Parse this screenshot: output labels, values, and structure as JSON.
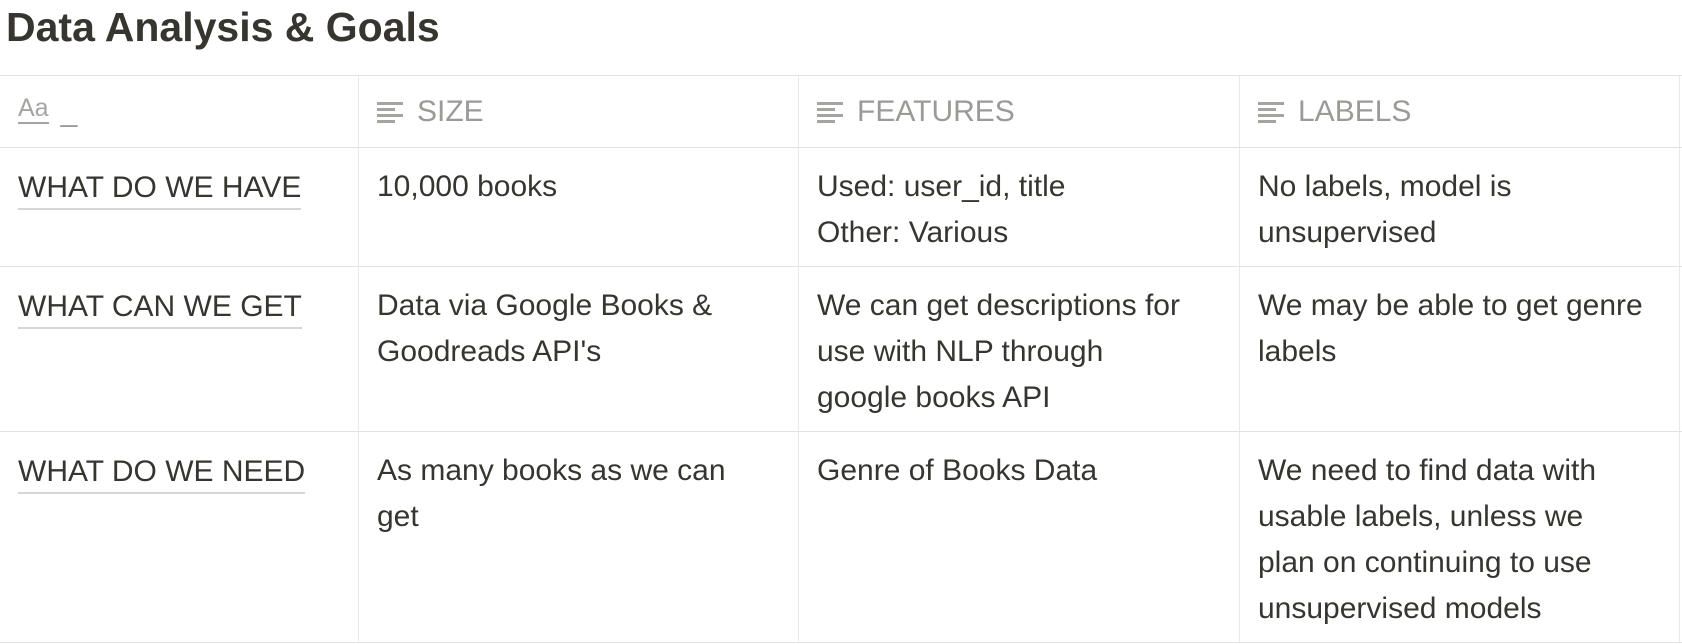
{
  "page": {
    "title": "Data Analysis & Goals"
  },
  "table": {
    "columns": [
      {
        "label": "_",
        "icon": "title-property-icon"
      },
      {
        "label": "SIZE",
        "icon": "text-property-icon"
      },
      {
        "label": "FEATURES",
        "icon": "text-property-icon"
      },
      {
        "label": "LABELS",
        "icon": "text-property-icon"
      }
    ],
    "title_icon_glyph": "Aa",
    "rows": [
      {
        "title": "WHAT DO WE HAVE",
        "size": [
          "10,000 books"
        ],
        "features": [
          "Used: user_id, title",
          "Other: Various"
        ],
        "labels": [
          "No labels, model is",
          "unsupervised"
        ]
      },
      {
        "title": "WHAT CAN WE GET",
        "size": [
          "Data via Google Books &",
          "Goodreads API's"
        ],
        "features": [
          "We can get descriptions for",
          "use with NLP through",
          "google books API"
        ],
        "labels": [
          "We may be able to get genre",
          "labels"
        ]
      },
      {
        "title": "WHAT DO WE NEED",
        "size": [
          "As many books as we can",
          "get"
        ],
        "features": [
          "Genre of Books Data"
        ],
        "labels": [
          "We need to find data with",
          "usable labels, unless we",
          "plan on continuing to use",
          "unsupervised models"
        ]
      }
    ]
  },
  "colors": {
    "text": "#37352f",
    "muted": "#9b9a97",
    "border": "#e3e2e0"
  }
}
